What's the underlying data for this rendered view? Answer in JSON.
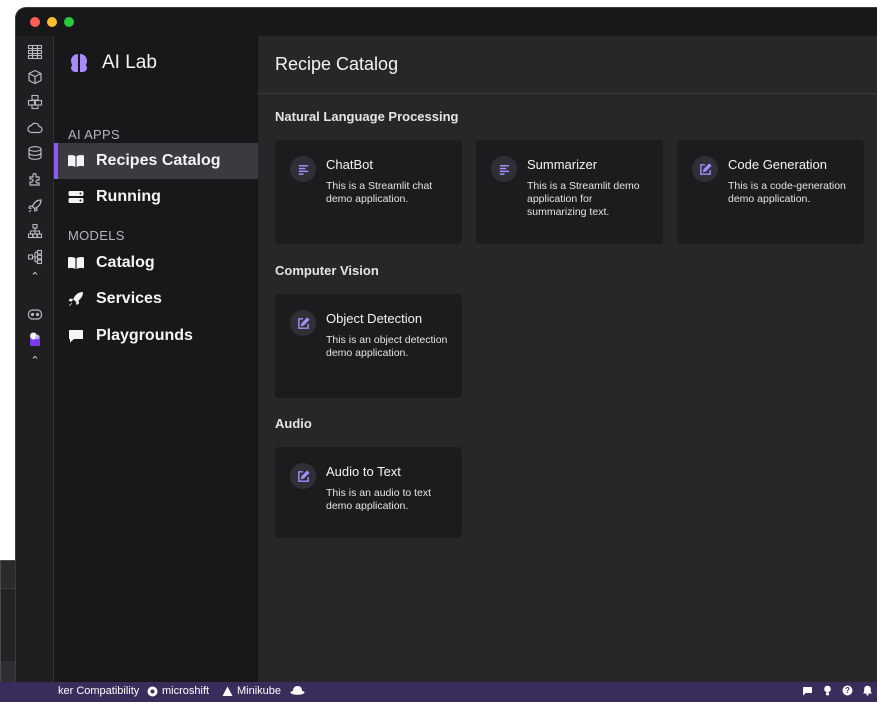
{
  "window": {
    "traffic_lights": [
      "#ff5f57",
      "#febc2e",
      "#28c840"
    ]
  },
  "rail": {
    "icons": [
      "dashboard-icon",
      "container-icon",
      "pods-icon",
      "cloud-icon",
      "database-icon",
      "extensions-icon",
      "rocket-icon",
      "network-icon",
      "hierarchy-icon",
      "chevron-up-icon",
      "robot-icon",
      "ai-lab-icon",
      "chevron-up-icon"
    ]
  },
  "nav": {
    "brand": {
      "title": "AI Lab",
      "icon": "brain-icon",
      "color": "#a78bfa"
    },
    "sections": [
      {
        "title": "AI APPS"
      },
      {
        "title": "MODELS"
      }
    ],
    "items": [
      {
        "label": "Recipes Catalog",
        "icon": "book-icon",
        "active": true
      },
      {
        "label": "Running",
        "icon": "server-icon",
        "active": false
      },
      {
        "label": "Catalog",
        "icon": "book-icon",
        "active": false
      },
      {
        "label": "Services",
        "icon": "rocket-icon",
        "active": false
      },
      {
        "label": "Playgrounds",
        "icon": "chat-icon",
        "active": false
      }
    ]
  },
  "main": {
    "title": "Recipe Catalog",
    "categories": [
      {
        "title": "Natural Language Processing",
        "cards": [
          {
            "title": "ChatBot",
            "description": "This is a Streamlit chat demo application.",
            "icon": "text-lines-icon"
          },
          {
            "title": "Summarizer",
            "description": "This is a Streamlit demo application for summarizing text.",
            "icon": "text-lines-icon"
          },
          {
            "title": "Code Generation",
            "description": "This is a code-generation demo application.",
            "icon": "edit-icon"
          }
        ]
      },
      {
        "title": "Computer Vision",
        "cards": [
          {
            "title": "Object Detection",
            "description": "This is an object detection demo application.",
            "icon": "edit-icon"
          }
        ]
      },
      {
        "title": "Audio",
        "cards": [
          {
            "title": "Audio to Text",
            "description": "This is an audio to text demo application.",
            "icon": "edit-icon"
          }
        ]
      }
    ]
  },
  "statusbar": {
    "items": [
      {
        "label": "ker Compatibility"
      },
      {
        "label": "microshift",
        "icon": "microshift-icon"
      },
      {
        "label": "Minikube",
        "icon": "minikube-icon"
      },
      {
        "label": "",
        "icon": "hat-icon"
      }
    ],
    "right_icons": [
      "chat-bubble-icon",
      "lightbulb-icon",
      "help-icon",
      "bell-icon"
    ],
    "background": "#3a2d5c"
  },
  "colors": {
    "accent": "#8b5cf6",
    "card_icon": "#a78bfa"
  }
}
